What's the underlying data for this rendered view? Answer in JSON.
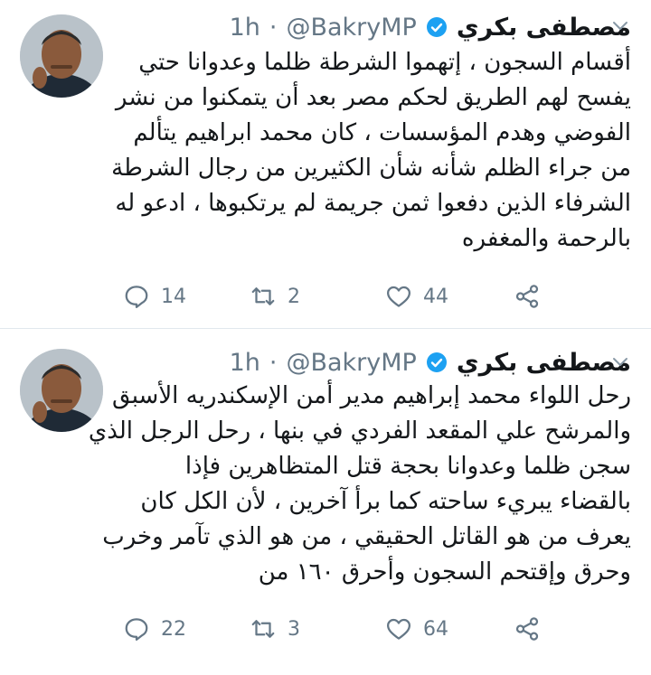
{
  "colors": {
    "text": "#14171a",
    "muted": "#657786",
    "divider": "#e1e8ed",
    "verified": "#1da1f2"
  },
  "icons": {
    "reply": "reply-icon",
    "retweet": "retweet-icon",
    "like": "heart-icon",
    "share": "share-icon",
    "more": "chevron-down-icon",
    "verified": "verified-badge-icon"
  },
  "tweets": [
    {
      "author": {
        "name": "مصطفى بكري",
        "handle": "@BakryMP",
        "time": "1h"
      },
      "lines": [
        "أقسام السجون ، إتهموا الشرطة ظلما وعدوانا حتي",
        "يفسح لهم الطريق لحكم مصر بعد أن يتمكنوا من نشر",
        "الفوضي وهدم المؤسسات ، كان محمد ابراهيم يتألم",
        "من جراء الظلم شأنه شأن الكثيرين من رجال الشرطة",
        "الشرفاء الذين دفعوا ثمن جريمة لم يرتكبوها ، ادعو له",
        "بالرحمة والمغفره"
      ],
      "counts": {
        "replies": "14",
        "retweets": "2",
        "likes": "44"
      }
    },
    {
      "author": {
        "name": "مصطفى بكري",
        "handle": "@BakryMP",
        "time": "1h"
      },
      "lines": [
        "رحل اللواء محمد إبراهيم مدير أمن الإسكندريه الأسبق",
        "والمرشح علي المقعد الفردي في بنها ، رحل الرجل الذي",
        "سجن ظلما وعدوانا بحجة قتل المتظاهرين فإذا",
        "بالقضاء يبريء ساحته كما برأ آخرين ، لأن الكل كان",
        "يعرف من هو القاتل الحقيقي ، من هو الذي تآمر وخرب",
        "وحرق وإقتحم السجون وأحرق ١٦٠ من"
      ],
      "counts": {
        "replies": "22",
        "retweets": "3",
        "likes": "64"
      }
    }
  ]
}
